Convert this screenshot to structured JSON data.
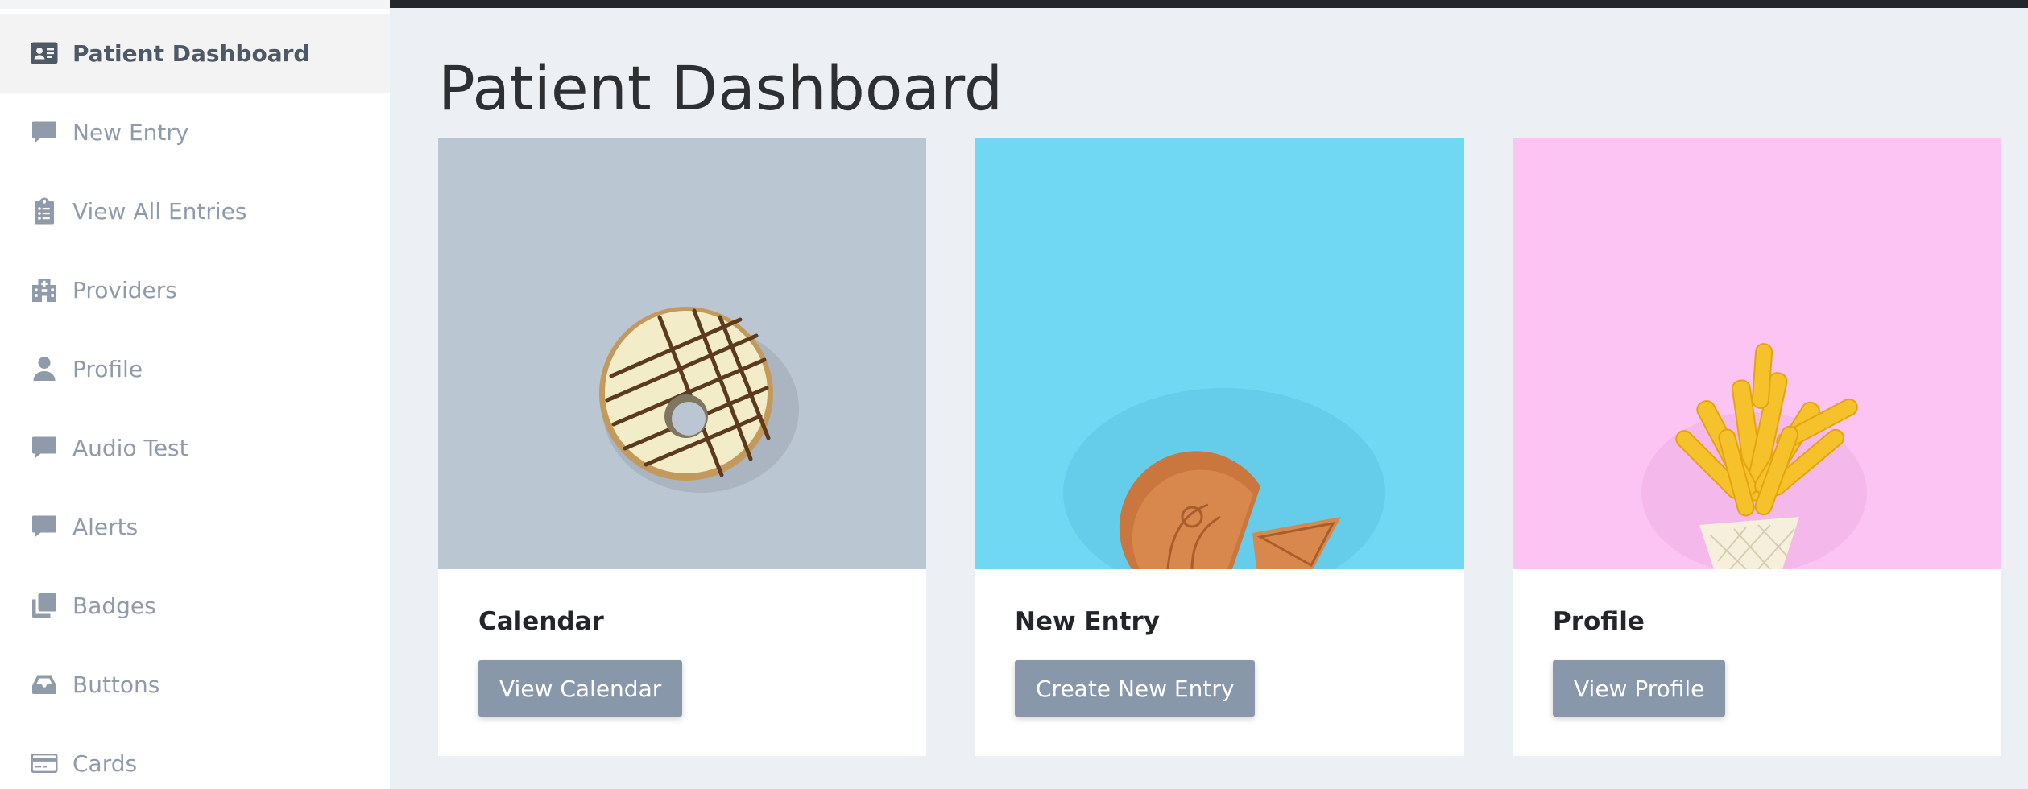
{
  "sidebar": {
    "items": [
      {
        "label": "Patient Dashboard",
        "icon": "id-card-icon",
        "active": true
      },
      {
        "label": "New Entry",
        "icon": "comment-icon"
      },
      {
        "label": "View All Entries",
        "icon": "clipboard-list-icon"
      },
      {
        "label": "Providers",
        "icon": "hospital-building-icon"
      },
      {
        "label": "Profile",
        "icon": "user-icon"
      },
      {
        "label": "Audio Test",
        "icon": "comment-icon"
      },
      {
        "label": "Alerts",
        "icon": "comment-icon"
      },
      {
        "label": "Badges",
        "icon": "clone-icon"
      },
      {
        "label": "Buttons",
        "icon": "inbox-tray-icon"
      },
      {
        "label": "Cards",
        "icon": "credit-card-icon"
      }
    ]
  },
  "page": {
    "title": "Patient Dashboard"
  },
  "cards": [
    {
      "title": "Calendar",
      "button": "View Calendar",
      "image": "donut-photo",
      "image_bg": "#bac6d2"
    },
    {
      "title": "New Entry",
      "button": "Create New Entry",
      "image": "mooncake-photo",
      "image_bg": "#70d8f2"
    },
    {
      "title": "Profile",
      "button": "View Profile",
      "image": "pasta-photo",
      "image_bg": "#fbc4f3"
    }
  ],
  "colors": {
    "topbar": "#23262d",
    "background": "#ecf0f4",
    "button": "#8897a9",
    "nav_active_text": "#4e5968",
    "nav_text": "#8f9aaa"
  }
}
